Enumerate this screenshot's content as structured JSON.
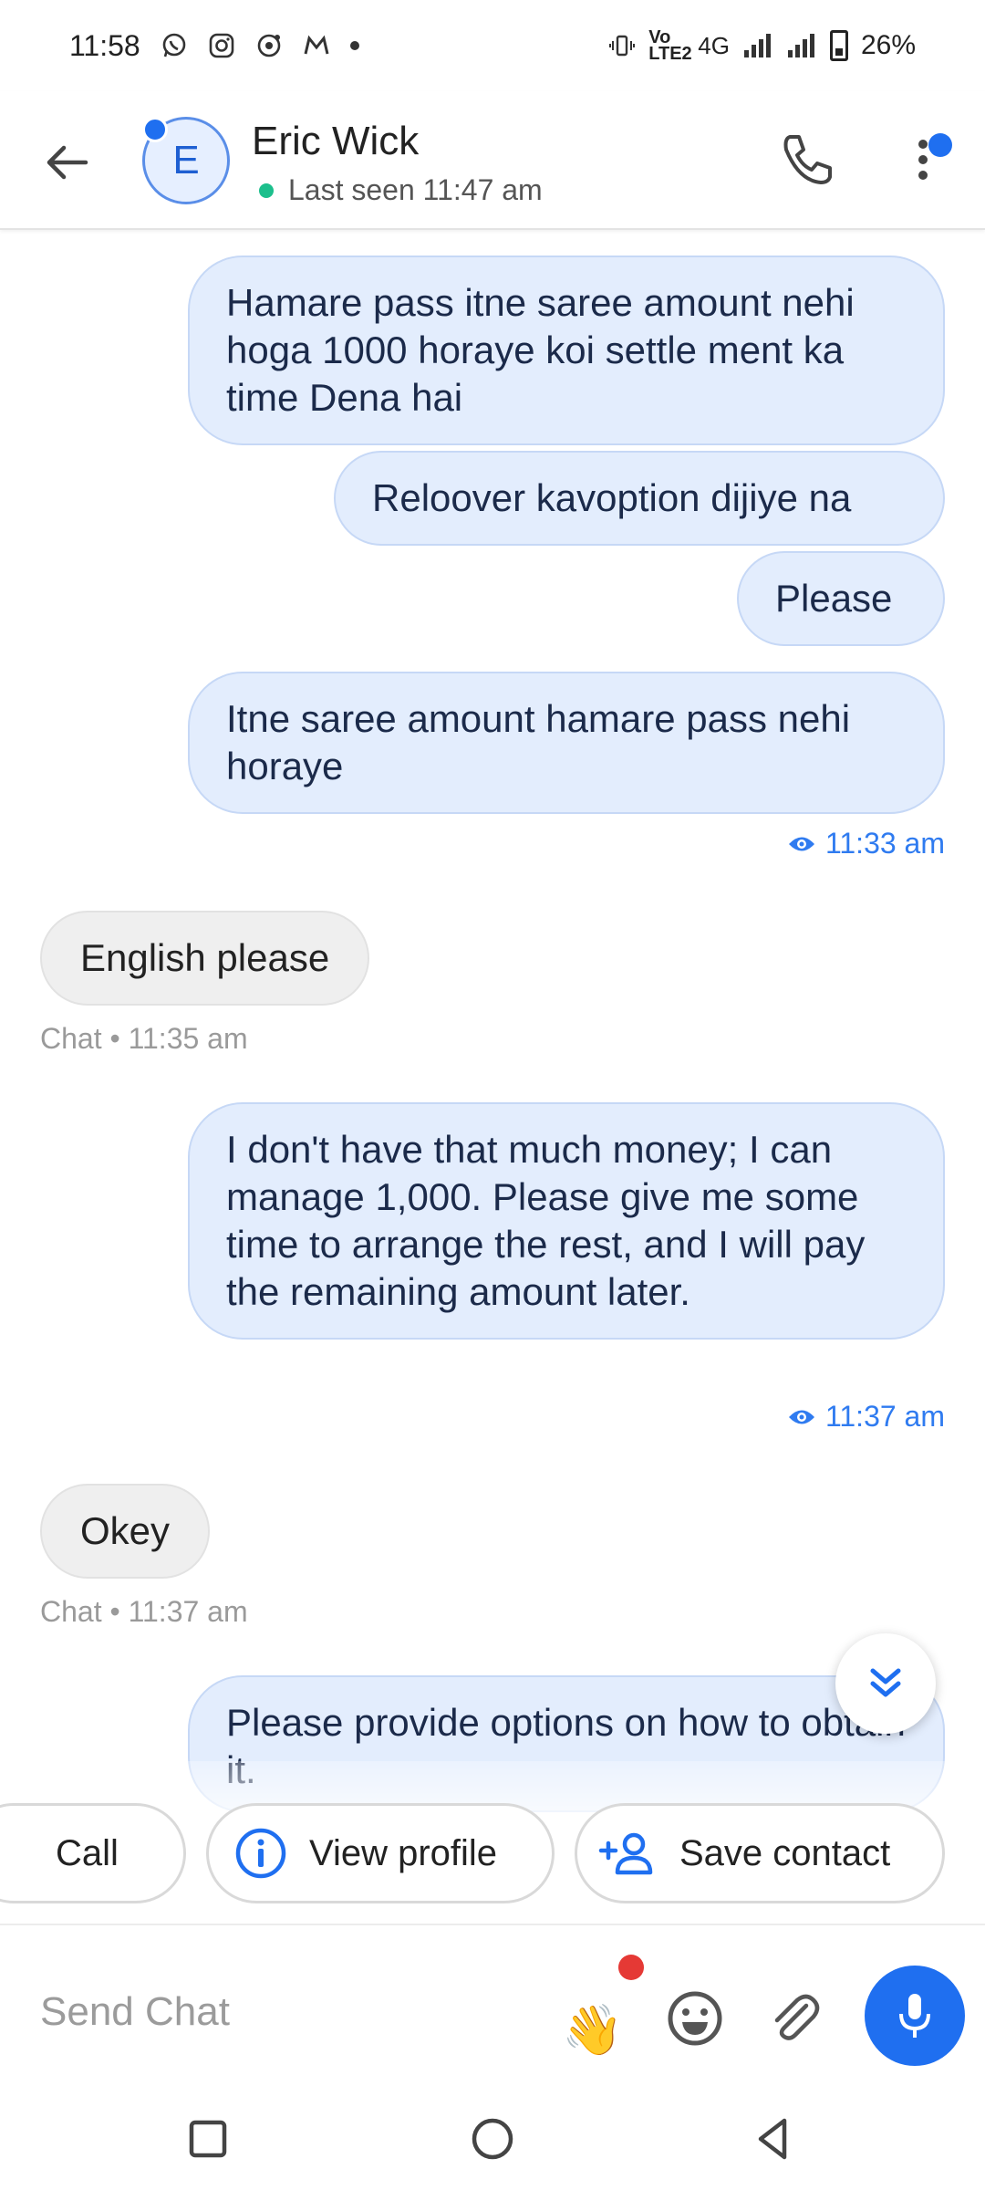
{
  "status_bar": {
    "time": "11:58",
    "network_label": "Vo LTE2",
    "network_type": "4G",
    "battery": "26%",
    "icons": [
      "whatsapp-icon",
      "instagram-icon",
      "threads-icon",
      "gmail-icon",
      "vibrate-icon",
      "signal-icon",
      "battery-icon"
    ]
  },
  "header": {
    "avatar_letter": "E",
    "name": "Eric Wick",
    "last_seen": "Last seen 11:47 am",
    "accent": "#1f6ff0"
  },
  "messages": [
    {
      "dir": "out",
      "text": "Hamare pass itne saree amount nehi hoga 1000 horaye koi settle ment ka time Dena hai"
    },
    {
      "dir": "out",
      "text": "Reloover kavoption dijiye na"
    },
    {
      "dir": "out",
      "text": "Please"
    },
    {
      "dir": "out",
      "text": "Itne saree amount hamare pass nehi horaye"
    },
    {
      "dir": "in",
      "text": "English please"
    },
    {
      "dir": "out",
      "text": "I don't have that much money; I can manage 1,000. Please give me some time to arrange the rest, and I will pay the remaining amount later."
    },
    {
      "dir": "in",
      "text": "Okey"
    },
    {
      "dir": "out",
      "text": "Please provide options on how to obtain it."
    }
  ],
  "timestamps": {
    "seen_1": "11:33 am",
    "chat_1": "Chat • 11:35 am",
    "seen_2": "11:37 am",
    "chat_2": "Chat • 11:37 am"
  },
  "actions": {
    "call": "Call",
    "view_profile": "View profile",
    "save_contact": "Save contact"
  },
  "compose": {
    "placeholder": "Send Chat",
    "wave_emoji": "👋"
  }
}
